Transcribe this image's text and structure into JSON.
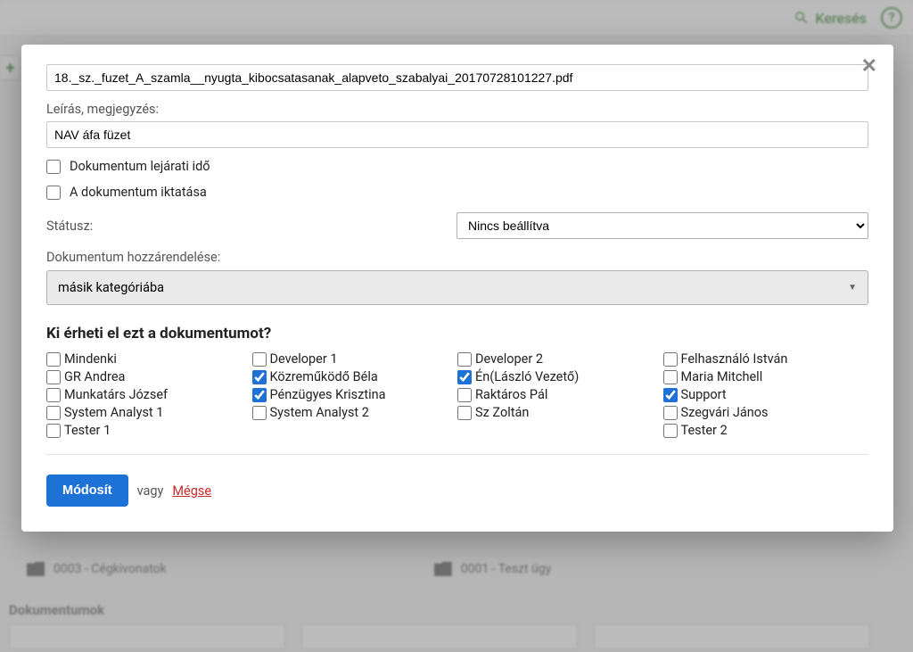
{
  "background": {
    "search_label": "Keresés",
    "help_symbol": "?",
    "plus_symbol": "+",
    "folder1": "0003 - Cégkivonatok",
    "folder2": "0001 - Teszt ügy",
    "section_title": "Dokumentumok"
  },
  "modal": {
    "filename": "18._sz._fuzet_A_szamla__nyugta_kibocsatasanak_alapveto_szabalyai_20170728101227.pdf",
    "description_label": "Leírás, megjegyzés:",
    "description_value": "NAV áfa füzet",
    "expiry_label": "Dokumentum lejárati idő",
    "register_label": "A dokumentum iktatása",
    "status_label": "Státusz:",
    "status_value": "Nincs beállítva",
    "assign_label": "Dokumentum hozzárendelése:",
    "assign_value": "másik kategóriába",
    "access_heading": "Ki érheti el ezt a dokumentumot?",
    "users": [
      {
        "name": "Mindenki",
        "checked": false
      },
      {
        "name": "GR Andrea",
        "checked": false
      },
      {
        "name": "Munkatárs József",
        "checked": false
      },
      {
        "name": "System Analyst 1",
        "checked": false
      },
      {
        "name": "Tester 1",
        "checked": false
      },
      {
        "name": "Developer 1",
        "checked": false
      },
      {
        "name": "Közreműködő Béla",
        "checked": true
      },
      {
        "name": "Pénzügyes Krisztina",
        "checked": true
      },
      {
        "name": "System Analyst 2",
        "checked": false
      },
      {
        "name": "",
        "checked": false
      },
      {
        "name": "Developer 2",
        "checked": false
      },
      {
        "name": "Én(László Vezető)",
        "checked": true
      },
      {
        "name": "Raktáros Pál",
        "checked": false
      },
      {
        "name": "Sz Zoltán",
        "checked": false
      },
      {
        "name": "",
        "checked": false
      },
      {
        "name": "Felhasználó István",
        "checked": false
      },
      {
        "name": "Maria Mitchell",
        "checked": false
      },
      {
        "name": "Support",
        "checked": true
      },
      {
        "name": "Szegvári János",
        "checked": false
      },
      {
        "name": "Tester 2",
        "checked": false
      }
    ],
    "submit_label": "Módosít",
    "or_label": "vagy",
    "cancel_label": "Mégse"
  }
}
